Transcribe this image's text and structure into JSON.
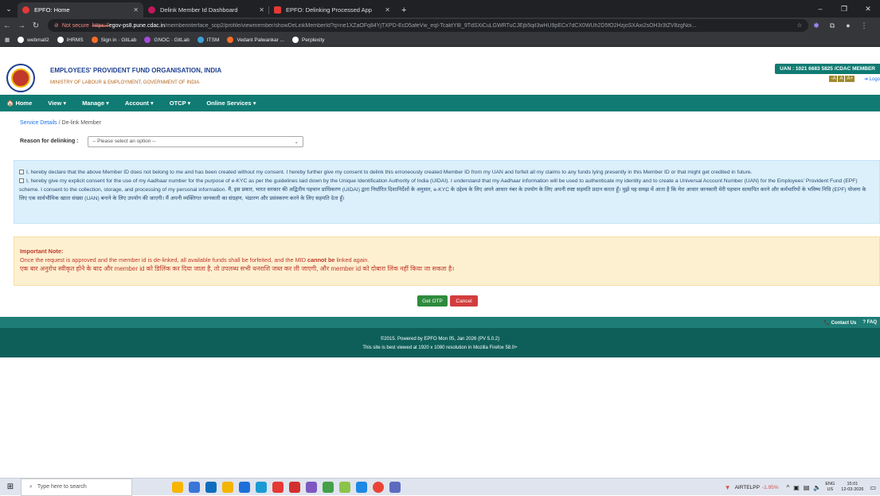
{
  "browser": {
    "tabs": [
      {
        "title": "EPFO: Home",
        "favicon_color": "#e53935",
        "active": true
      },
      {
        "title": "Delink Member Id Dashboard",
        "favicon_color": "#c2185b",
        "active": false
      },
      {
        "title": "EPFO: Delinking Processed App",
        "favicon_color": "#e53935",
        "active": false
      }
    ],
    "not_secure_label": "Not secure",
    "url_scheme": "https://",
    "url_host": "egov-ps8.pune.cdac.in",
    "url_path": "/memberinterface_sop2/profile/viewmember/showDeLinkMemberId?q=ne1XZaOFq84YjTXPD-EcD5afeVw_eqI-TcaktYl8_9TdSXiCuLGWRTuCJEjb5qiI3wHU9pECx7dCX0WUh2D5fO2HzjoSXAxi2sOH3r3tZV8zgNoi...",
    "bookmarks": [
      {
        "label": "webmail2",
        "color": "#ffffff"
      },
      {
        "label": "IHRMS",
        "color": "#ffffff"
      },
      {
        "label": "Sign in · GitLab",
        "color": "#fc6d26"
      },
      {
        "label": "GNOC · GitLab",
        "color": "#a44bd8"
      },
      {
        "label": "ITSM",
        "color": "#3aa0d8"
      },
      {
        "label": "Vedant Palwankar ...",
        "color": "#fc6d26"
      },
      {
        "label": "Perplexity",
        "color": "#ffffff"
      }
    ]
  },
  "header": {
    "org_name": "EMPLOYEES' PROVIDENT FUND ORGANISATION, INDIA",
    "ministry": "MINISTRY OF LABOUR & EMPLOYMENT, GOVERNMENT OF INDIA",
    "uan": "UAN : 1021 6683 5825 /CDAC MEMBER",
    "font_a_small": "-A",
    "font_a": "A",
    "font_a_large": "A+",
    "logout": "Logo"
  },
  "menu": [
    "Home",
    "View",
    "Manage",
    "Account",
    "OTCP",
    "Online Services"
  ],
  "breadcrumb": {
    "link": "Service Details",
    "sep": "/",
    "current": "De-link Member"
  },
  "form": {
    "reason_label": "Reason for delinking :",
    "reason_placeholder": "-- Please select an option --"
  },
  "consent": {
    "item1": "I, hereby declare that the above Member ID does not belong to me and has been created without my consent. I hereby further give my consent to delink this erroneously created Member ID from my UAN and forfeit all my claims to any funds lying presently in this Member ID or that might get credited in future.",
    "item2": "I, hereby give my explicit consent for the use of my Aadhaar number for the purpose of e-KYC as per the guidelines laid down by the Unique Identification Authority of India (UIDAI). I understand that my Aadhaar information will be used to authenticate my identity and to create a Universal Account Number (UAN) for the Employees' Provident Fund (EPF) scheme. I consent to the collection, storage, and processing of my personal information.  मैं, इस प्रकार, भारत सरकार की अद्वितीय पहचान प्राधिकरण (UIDAI) द्वारा निर्धारित दिशानिर्देशों के अनुसार, e-KYC के उद्देश्य के लिए अपने आधार नंबर के उपयोग के लिए अपनी स्पष्ट सहमति प्रदान करता हूँ। मुझे यह समझ में आता है कि मेरा आधार जानकारी मेरी पहचान सत्यापित करने और कर्मचारियों के भविष्य निधि (EPF) योजना के लिए एक सार्वभौमिक खाता संख्या (UAN) बनाने के लिए उपयोग की जाएगी। मैं अपनी व्यक्तिगत जानकारी का संग्रहण, भंडारण और प्रसंस्करण करने के लिए सहमति देता हूँ।"
  },
  "note": {
    "title": "Important Note:",
    "line1_pre": "Once the request is approved and the member id is de-linked, all available funds shall be forfeited, and the MID",
    "line1_bold": "cannot be",
    "line1_post": "linked again.",
    "line2_hi": "एक बार अनुरोध स्वीकृत होने के बाद और member id को डिलिंक कर दिया जाता है, तो उपलब्ध सभी धनराशि जब्त कर ली जाएगी, और member id को दोबारा लिंक नहीं किया जा सकता है।"
  },
  "buttons": {
    "get_otp": "Get OTP",
    "cancel": "Cancel"
  },
  "footer": {
    "contact": "Contact Us",
    "faq": "FAQ",
    "powered": "©2015. Powered by EPFO Mon 05, Jan 2026 (PV 5.0.2)",
    "best_view": "This site is best viewed at 1920 x 1080 resolution in Mozilla Firefox 58.0+"
  },
  "taskbar": {
    "search_placeholder": "Type here to search",
    "app_colors": [
      "#f7b500",
      "#3a76d8",
      "#0f6cbd",
      "#f4b400",
      "#1e6fd9",
      "#1c9ad6",
      "#e53935",
      "#d32f2f",
      "#7e57c2",
      "#43a047",
      "#8bc34a",
      "#1e88e5",
      "#ea4335",
      "#5c6bc0"
    ],
    "network": "AIRTELPP",
    "network_change": "-1.95%",
    "lang1": "ENG",
    "lang2": "US",
    "time": "15:01",
    "date": "12-03-2026"
  },
  "colors": {
    "teal": "#0f7b73",
    "teal_dark": "#0e5f5a",
    "otp_green": "#2e8b3d",
    "cancel_red": "#d33d3d"
  }
}
